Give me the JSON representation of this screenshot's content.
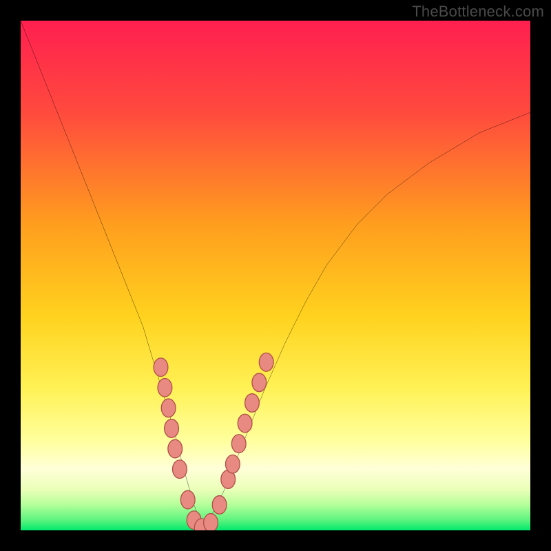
{
  "watermark": "TheBottleneck.com",
  "colors": {
    "black": "#000000",
    "red_top": "#ff1f4f",
    "orange_mid": "#ffb400",
    "yellow": "#ffff55",
    "pale_yellow": "#ffffbb",
    "green_bottom": "#00e96c",
    "curve": "#000000",
    "marker_fill": "#e88a82",
    "marker_stroke": "#b05048",
    "watermark": "#4a4a4a"
  },
  "chart_data": {
    "type": "line",
    "title": "",
    "xlabel": "",
    "ylabel": "",
    "xlim": [
      0,
      100
    ],
    "ylim": [
      0,
      100
    ],
    "grid": false,
    "legend_position": "none",
    "series": [
      {
        "name": "bottleneck-curve",
        "x": [
          0,
          4,
          8,
          12,
          16,
          20,
          24,
          27,
          30,
          32,
          34,
          36,
          40,
          44,
          48,
          52,
          56,
          60,
          66,
          72,
          80,
          90,
          100
        ],
        "y": [
          100,
          90,
          80,
          70,
          60,
          50,
          40,
          30,
          20,
          12,
          5,
          0,
          8,
          18,
          28,
          37,
          45,
          52,
          60,
          66,
          72,
          78,
          82
        ]
      }
    ],
    "markers": [
      {
        "x": 27.5,
        "y": 32
      },
      {
        "x": 28.3,
        "y": 28
      },
      {
        "x": 29.0,
        "y": 24
      },
      {
        "x": 29.6,
        "y": 20
      },
      {
        "x": 30.3,
        "y": 16
      },
      {
        "x": 31.2,
        "y": 12
      },
      {
        "x": 32.8,
        "y": 6
      },
      {
        "x": 34.0,
        "y": 2
      },
      {
        "x": 35.5,
        "y": 0.5
      },
      {
        "x": 37.3,
        "y": 1.5
      },
      {
        "x": 39.0,
        "y": 5
      },
      {
        "x": 40.7,
        "y": 10
      },
      {
        "x": 41.6,
        "y": 13
      },
      {
        "x": 42.8,
        "y": 17
      },
      {
        "x": 44.0,
        "y": 21
      },
      {
        "x": 45.4,
        "y": 25
      },
      {
        "x": 46.8,
        "y": 29
      },
      {
        "x": 48.2,
        "y": 33
      }
    ]
  }
}
